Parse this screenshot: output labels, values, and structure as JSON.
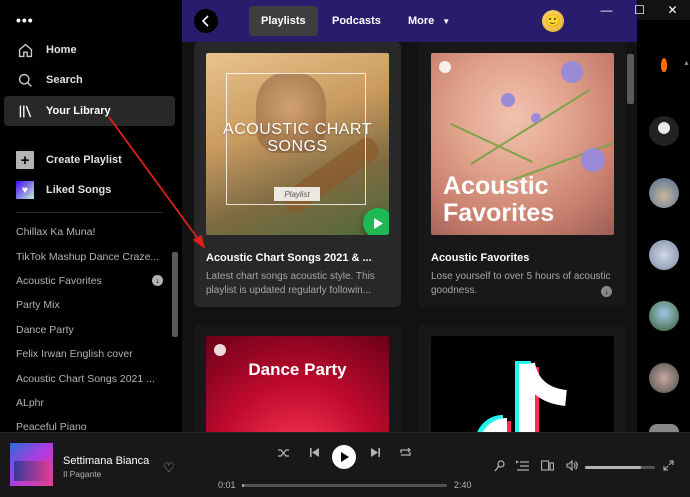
{
  "sidebar": {
    "menu_glyph": "•••",
    "nav": [
      {
        "label": "Home",
        "icon": "home-icon"
      },
      {
        "label": "Search",
        "icon": "search-icon"
      },
      {
        "label": "Your Library",
        "icon": "library-icon"
      }
    ],
    "create_playlist": "Create Playlist",
    "liked_songs": "Liked Songs",
    "playlists": [
      "Chillax Ka Muna!",
      "TikTok Mashup Dance Craze...",
      "Acoustic Favorites",
      "Party Mix",
      "Dance Party",
      "Felix Irwan English cover",
      "Acoustic Chart Songs 2021 ...",
      "ALphr",
      "Peaceful Piano"
    ]
  },
  "header": {
    "tabs": [
      "Playlists",
      "Podcasts",
      "More"
    ],
    "avatar_glyph": "🙂"
  },
  "window": {
    "minimize": "—",
    "maximize": "☐",
    "close": "✕"
  },
  "cards": [
    {
      "title": "Acoustic Chart Songs 2021 & ...",
      "description": "Latest chart songs acoustic style. This playlist is updated regularly followin...",
      "cover_title": "ACOUSTIC CHART SONGS",
      "cover_tag": "Playlist"
    },
    {
      "title": "Acoustic Favorites",
      "description": "Lose yourself to over 5 hours of acoustic goodness.",
      "cover_title": "Acoustic Favorites"
    },
    {
      "cover_title": "Dance Party"
    },
    {
      "cover_title": ""
    }
  ],
  "player": {
    "track": "Settimana Bianca",
    "artist": "Il Pagante",
    "elapsed": "0:01",
    "duration": "2:40",
    "progress": 0.01,
    "volume": 0.8
  },
  "colors": {
    "accent_green": "#1db954",
    "header_purple": "#2a1c6c",
    "annotation_red": "#e0201b"
  }
}
